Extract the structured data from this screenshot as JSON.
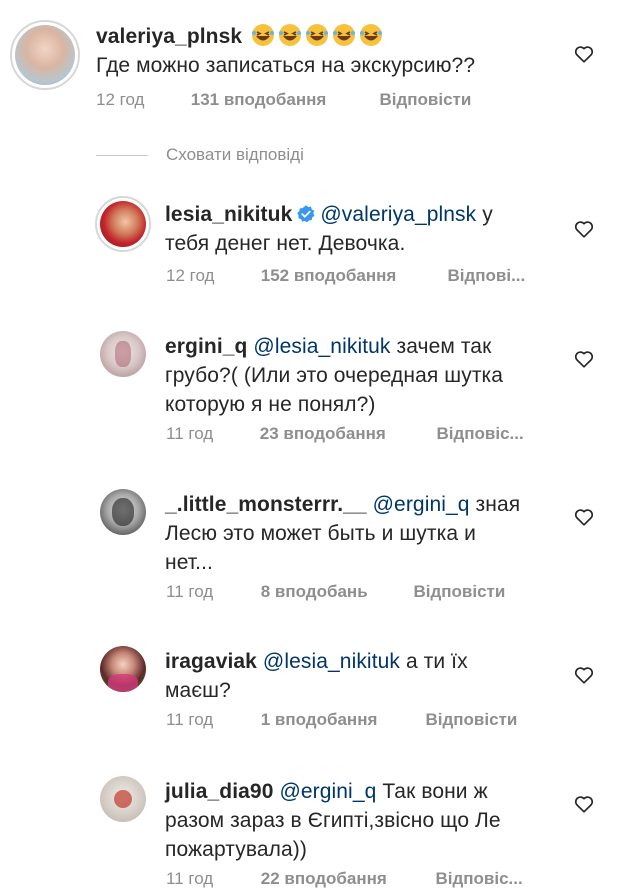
{
  "comments": [
    {
      "username": "valeriya_plnsk",
      "emoji_count": 5,
      "text": "Где можно записаться на экскурсию??",
      "time": "12 год",
      "likes": "131 вподобання",
      "reply": "Відповісти"
    }
  ],
  "hide_replies": "Сховати відповіді",
  "replies": [
    {
      "username": "lesia_nikituk",
      "verified": true,
      "mention": "@valeriya_plnsk",
      "text_line1": "у",
      "text_line2": "тебя денег нет. Девочка.",
      "time": "12 год",
      "likes": "152 вподобання",
      "reply": "Відпові..."
    },
    {
      "username": "ergini_q",
      "mention": "@lesia_nikituk",
      "text_line1": "зачем так",
      "text_line2": "грубо?( (Или это очередная шутка",
      "text_line3": "которую я не понял?)",
      "time": "11 год",
      "likes": "23 вподобання",
      "reply": "Відповіс..."
    },
    {
      "username": "_.little_monsterrr.__",
      "mention": "@ergini_q",
      "text_line1": "зная",
      "text_line2": "Лесю это может быть и шутка и",
      "text_line3": "нет...",
      "time": "11 год",
      "likes": "8 вподобань",
      "reply": "Відповісти"
    },
    {
      "username": "iragaviak",
      "mention": "@lesia_nikituk",
      "text_line1": "а ти їх",
      "text_line2": "маєш?",
      "time": "11 год",
      "likes": "1 вподобання",
      "reply": "Відповісти"
    },
    {
      "username": "julia_dia90",
      "mention": "@ergini_q",
      "text_line1": "Так вони ж",
      "text_line2": "разом зараз в Єгипті,звісно що Ле",
      "text_line3": "пожартувала))",
      "time": "11 год",
      "likes": "22 вподобання",
      "reply": "Відповіс..."
    }
  ],
  "colors": {
    "text": "#262626",
    "muted": "#8e8e8e",
    "mention": "#003569",
    "verified": "#3897f0"
  }
}
